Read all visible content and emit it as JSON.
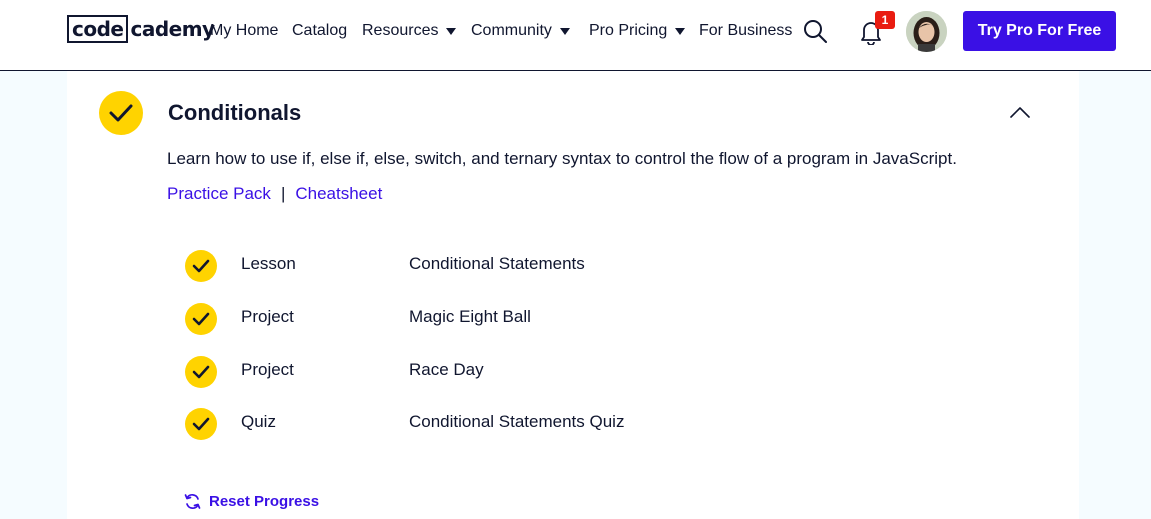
{
  "header": {
    "logo_box_text": "code",
    "logo_rest_text": "cademy",
    "nav": {
      "my_home": "My Home",
      "catalog": "Catalog",
      "resources": "Resources",
      "community": "Community",
      "pro_pricing": "Pro Pricing",
      "for_business": "For Business"
    },
    "notification_count": "1",
    "cta_label": "Try Pro For Free",
    "icons": [
      "search-icon",
      "bell-icon",
      "caret-down-icon"
    ]
  },
  "module": {
    "title": "Conditionals",
    "description": "Learn how to use if, else if, else, switch, and ternary syntax to control the flow of a program in JavaScript.",
    "practice_pack_label": "Practice Pack",
    "separator": "|",
    "cheatsheet_label": "Cheatsheet",
    "items": [
      {
        "type": "Lesson",
        "name": "Conditional Statements",
        "completed": true
      },
      {
        "type": "Project",
        "name": "Magic Eight Ball",
        "completed": true
      },
      {
        "type": "Project",
        "name": "Race Day",
        "completed": true
      },
      {
        "type": "Quiz",
        "name": "Conditional Statements Quiz",
        "completed": true
      }
    ],
    "reset_label": "Reset Progress"
  },
  "colors": {
    "accent": "#3a10e5",
    "check_yellow": "#ffd300",
    "text": "#10162f",
    "badge_red": "#e91c11",
    "page_bg": "#f5fcff"
  }
}
